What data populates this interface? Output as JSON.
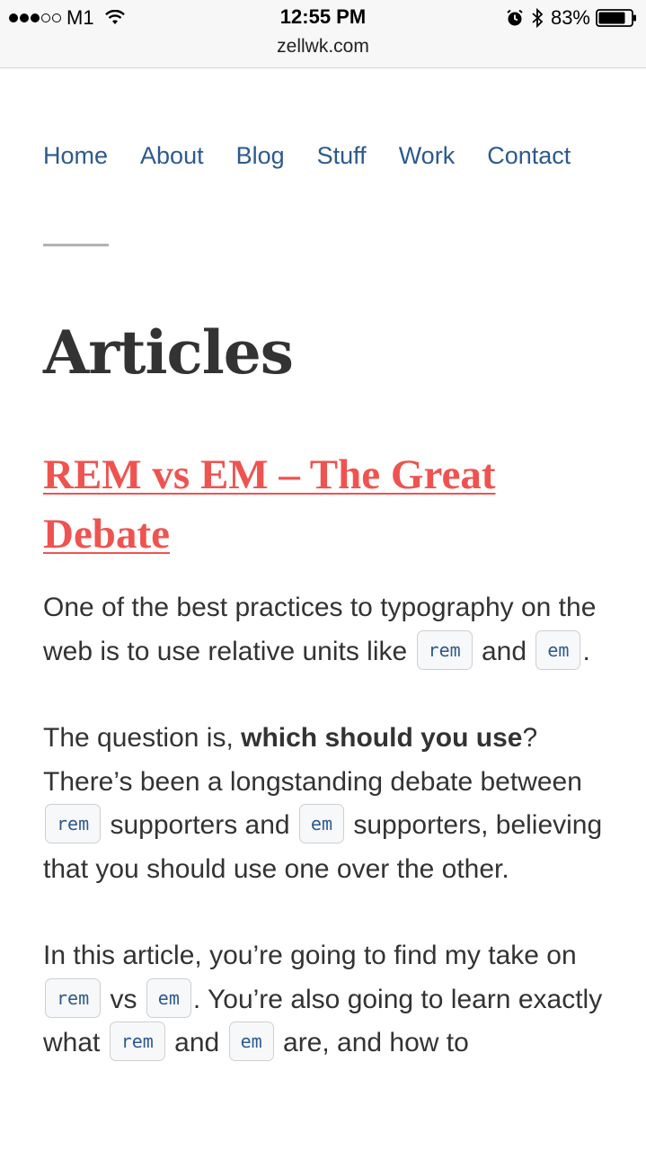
{
  "status_bar": {
    "carrier": "M1",
    "time": "12:55 PM",
    "battery": "83%",
    "url": "zellwk.com",
    "battery_level": 0.83
  },
  "nav": {
    "items": [
      {
        "label": "Home"
      },
      {
        "label": "About"
      },
      {
        "label": "Blog"
      },
      {
        "label": "Stuff"
      },
      {
        "label": "Work"
      },
      {
        "label": "Contact"
      }
    ]
  },
  "page": {
    "title": "Articles"
  },
  "article": {
    "title": "REM vs EM – The Great Debate",
    "p1": {
      "t1": "One of the best practices to typography on the web is to use relative units like ",
      "c1": "rem",
      "t2": " and ",
      "c2": "em",
      "t3": "."
    },
    "p2": {
      "t1": "The question is, ",
      "bold": "which should you use",
      "t2": "? There’s been a longstanding debate between ",
      "c1": "rem",
      "t3": " supporters and ",
      "c2": "em",
      "t4": " supporters, believing that you should use one over the other."
    },
    "p3": {
      "t1": "In this article, you’re going to find my take on ",
      "c1": "rem",
      "t2": " vs ",
      "c2": "em",
      "t3": ". You’re also going to learn exactly what ",
      "c3": "rem",
      "t4": " and ",
      "c4": "em",
      "t5": " are, and how to"
    }
  },
  "colors": {
    "link": "#2d5a8c",
    "accent": "#ef5350",
    "text": "#333333"
  }
}
